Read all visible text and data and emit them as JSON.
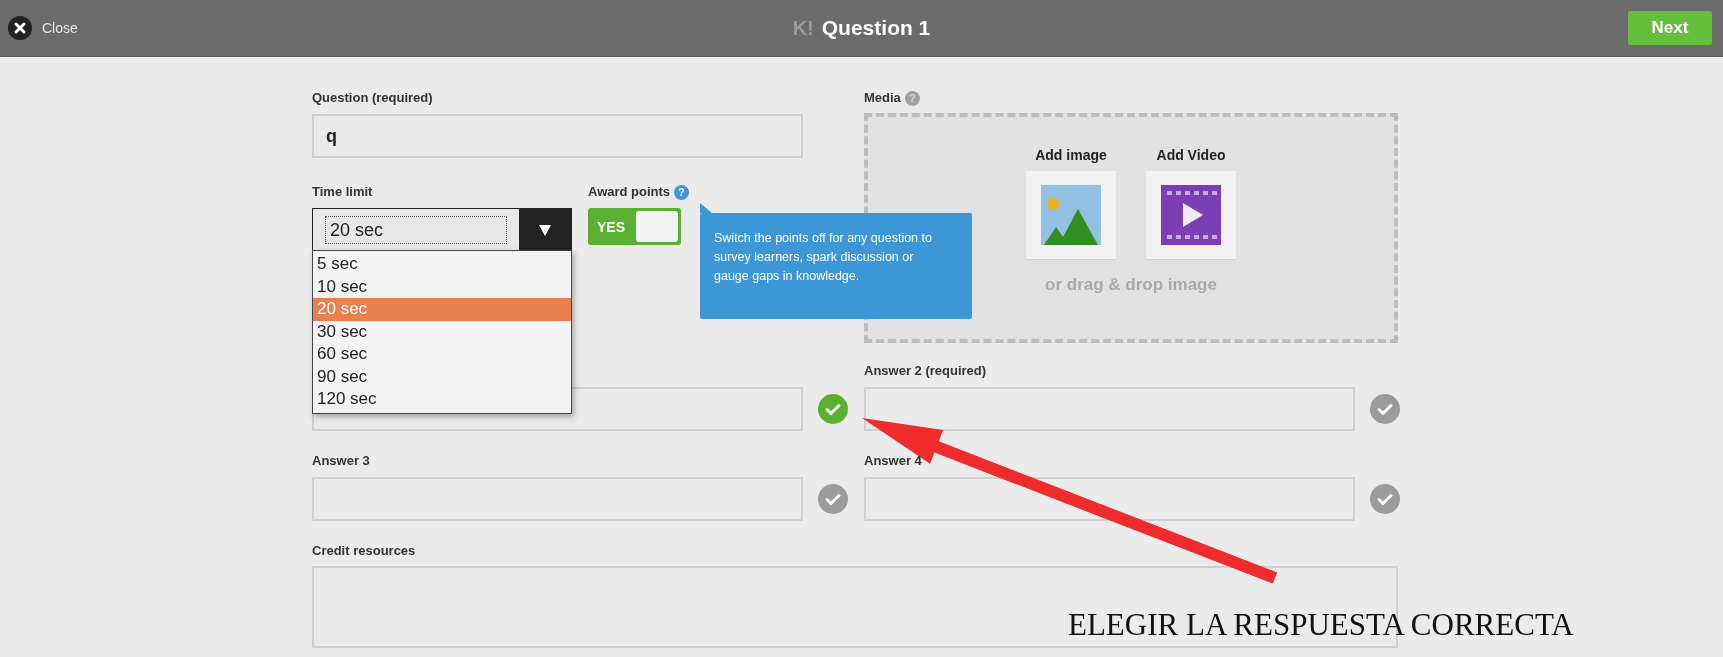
{
  "window": {
    "logo": "K!",
    "title": "Question 1"
  },
  "toolbar": {
    "close_label": "Close",
    "next_label": "Next"
  },
  "question": {
    "label": "Question (required)",
    "value": "q"
  },
  "time_limit": {
    "label": "Time limit",
    "value": "20 sec",
    "expanded": true,
    "options": [
      {
        "label": "5 sec",
        "selected": false
      },
      {
        "label": "10 sec",
        "selected": false
      },
      {
        "label": "20 sec",
        "selected": true
      },
      {
        "label": "30 sec",
        "selected": false
      },
      {
        "label": "60 sec",
        "selected": false
      },
      {
        "label": "90 sec",
        "selected": false
      },
      {
        "label": "120 sec",
        "selected": false
      }
    ]
  },
  "award_points": {
    "label": "Award points",
    "help_icon": "?",
    "on": true,
    "toggle_text": "YES",
    "tooltip": "Switch the points off for any question to survey learners, spark discussion or gauge gaps in knowledge."
  },
  "media": {
    "label": "Media",
    "help_icon": "?",
    "add_image": "Add image",
    "add_video": "Add Video",
    "drop_hint": "or drag & drop image"
  },
  "answers": [
    {
      "correct": true
    },
    {
      "label": "Answer 2 (required)",
      "correct": false
    },
    {
      "label": "Answer 3",
      "correct": false
    },
    {
      "label": "Answer 4",
      "correct": false
    }
  ],
  "credit": {
    "label": "Credit resources"
  },
  "annotation": {
    "text": "ELEGIR LA RESPUESTA CORRECTA"
  }
}
